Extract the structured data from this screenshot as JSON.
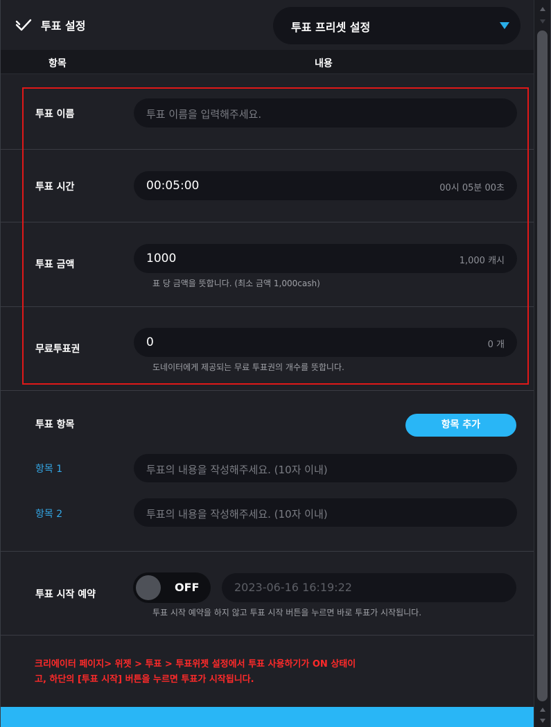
{
  "header": {
    "title": "투표 설정",
    "preset_label": "투표 프리셋 설정"
  },
  "columns": {
    "item": "항목",
    "content": "내용"
  },
  "form": {
    "name": {
      "label": "투표 이름",
      "placeholder": "투표 이름을 입력해주세요."
    },
    "time": {
      "label": "투표 시간",
      "value": "00:05:00",
      "suffix": "00시 05분 00초"
    },
    "amount": {
      "label": "투표 금액",
      "value": "1000",
      "suffix": "1,000 캐시",
      "hint": "표 당 금액을 뜻합니다. (최소 금액 1,000cash)"
    },
    "free": {
      "label": "무료투표권",
      "value": "0",
      "suffix": "0 개",
      "hint": "도네이터에게 제공되는 무료 투표권의 개수를 뜻합니다."
    }
  },
  "items": {
    "label": "투표 항목",
    "add_button": "항목 추가",
    "list": [
      {
        "label": "항목 1",
        "placeholder": "투표의 내용을 작성해주세요. (10자 이내)"
      },
      {
        "label": "항목 2",
        "placeholder": "투표의 내용을 작성해주세요. (10자 이내)"
      }
    ]
  },
  "schedule": {
    "label": "투표 시작 예약",
    "toggle": "OFF",
    "datetime_placeholder": "2023-06-16 16:19:22",
    "hint": "투표 시작 예약을 하지 않고 투표 시작 버튼을 누르면 바로 투표가 시작됩니다."
  },
  "notice": {
    "line1": "크리에이터 페이지> 위젯 > 투표 > 투표위젯 설정에서 투표 사용하기가 ON 상태이",
    "line2": "고, 하단의 [투표 시작] 버튼을 누르면 투표가 시작됩니다."
  },
  "colors": {
    "accent": "#29b6f6",
    "highlight": "#e01818",
    "warning": "#ff2a2a"
  },
  "icons": {
    "title": "check-icon",
    "preset": "triangle-down-icon"
  }
}
